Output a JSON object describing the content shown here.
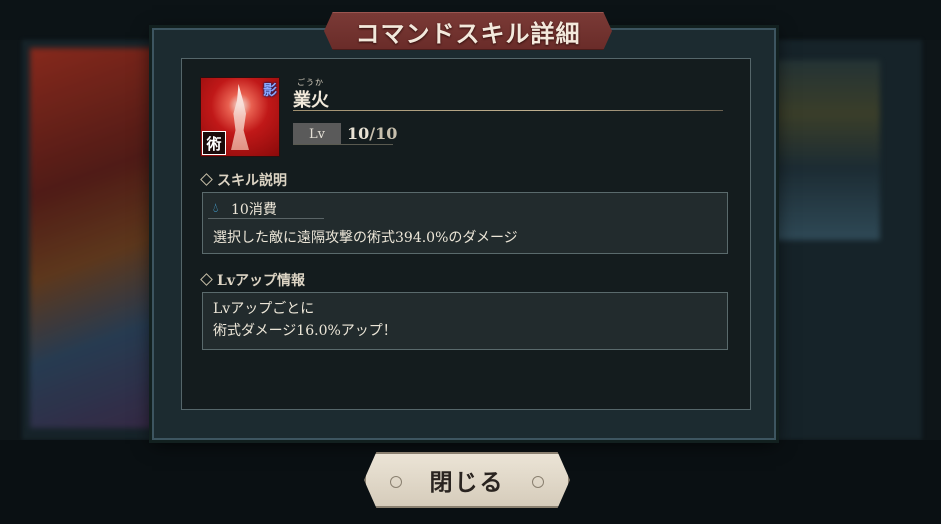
{
  "dialog": {
    "title": "コマンドスキル詳細",
    "close_label": "閉じる"
  },
  "skill": {
    "reading": "ごうか",
    "name": "業火",
    "icon_badge": "影",
    "icon_type": "術",
    "level_label": "Lv",
    "level_current": "10",
    "level_separator": "/",
    "level_max": "10"
  },
  "description": {
    "header": "スキル説明",
    "cost_icon": "drop-icon",
    "cost_text": "10消費",
    "text": "選択した敵に遠隔攻撃の術式394.0%のダメージ"
  },
  "level_up": {
    "header": "Lvアップ情報",
    "line1": "Lvアップごとに",
    "line2": "術式ダメージ16.0%アップ！"
  },
  "colors": {
    "title_banner": "#6a2c29",
    "panel": "#141c1e",
    "cost_icon": "#4ab8f0"
  }
}
